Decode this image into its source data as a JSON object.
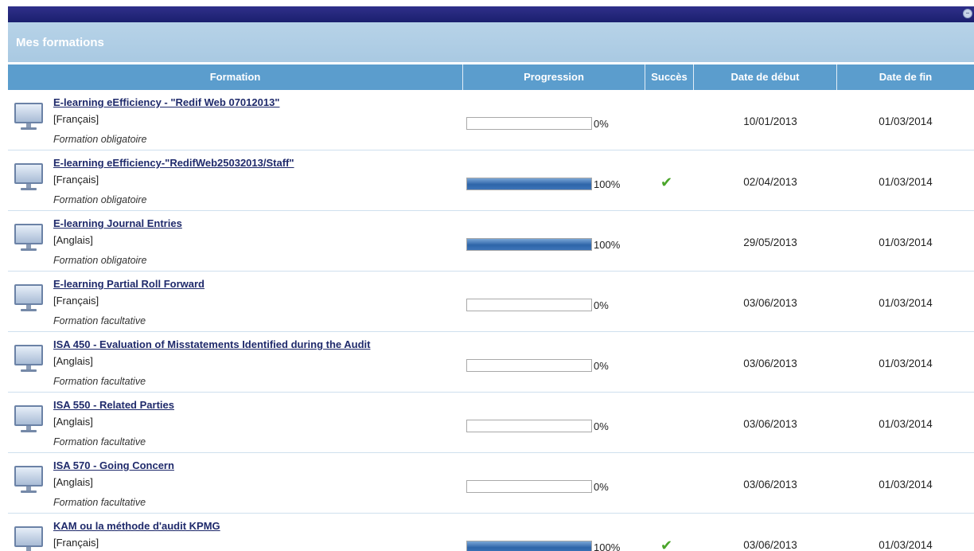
{
  "panel": {
    "title": "Mes formations",
    "collapse_icon": "minus-circle-icon"
  },
  "columns": {
    "formation": "Formation",
    "progression": "Progression",
    "succes": "Succès",
    "date_debut": "Date de début",
    "date_fin": "Date de fin"
  },
  "courses": [
    {
      "title": "E-learning eEfficiency - \"Redif Web 07012013\"",
      "language": "[Français]",
      "type": "Formation obligatoire",
      "progress": 0,
      "progress_label": "0%",
      "success": false,
      "start": "10/01/2013",
      "end": "01/03/2014"
    },
    {
      "title": "E-learning eEfficiency-\"RedifWeb25032013/Staff\"",
      "language": "[Français]",
      "type": "Formation obligatoire",
      "progress": 100,
      "progress_label": "100%",
      "success": true,
      "start": "02/04/2013",
      "end": "01/03/2014"
    },
    {
      "title": "E-learning Journal Entries",
      "language": "[Anglais]",
      "type": "Formation obligatoire",
      "progress": 100,
      "progress_label": "100%",
      "success": false,
      "start": "29/05/2013",
      "end": "01/03/2014"
    },
    {
      "title": "E-learning Partial Roll Forward",
      "language": "[Français]",
      "type": "Formation facultative",
      "progress": 0,
      "progress_label": "0%",
      "success": false,
      "start": "03/06/2013",
      "end": "01/03/2014"
    },
    {
      "title": "ISA 450 - Evaluation of Misstatements Identified during the Audit",
      "language": "[Anglais]",
      "type": "Formation facultative",
      "progress": 0,
      "progress_label": "0%",
      "success": false,
      "start": "03/06/2013",
      "end": "01/03/2014"
    },
    {
      "title": "ISA 550 - Related Parties",
      "language": "[Anglais]",
      "type": "Formation facultative",
      "progress": 0,
      "progress_label": "0%",
      "success": false,
      "start": "03/06/2013",
      "end": "01/03/2014"
    },
    {
      "title": "ISA 570 - Going Concern",
      "language": "[Anglais]",
      "type": "Formation facultative",
      "progress": 0,
      "progress_label": "0%",
      "success": false,
      "start": "03/06/2013",
      "end": "01/03/2014"
    },
    {
      "title": "KAM ou la méthode d'audit KPMG",
      "language": "[Français]",
      "type": "",
      "progress": 100,
      "progress_label": "100%",
      "success": true,
      "start": "03/06/2013",
      "end": "01/03/2014"
    }
  ],
  "icons": {
    "course": "monitor-icon",
    "success": "checkmark-icon"
  },
  "colors": {
    "header_blue": "#5b9dcd",
    "topbar": "#1a1f6e",
    "progress_fill": "#2e65a9",
    "success_green": "#4aa52a"
  }
}
